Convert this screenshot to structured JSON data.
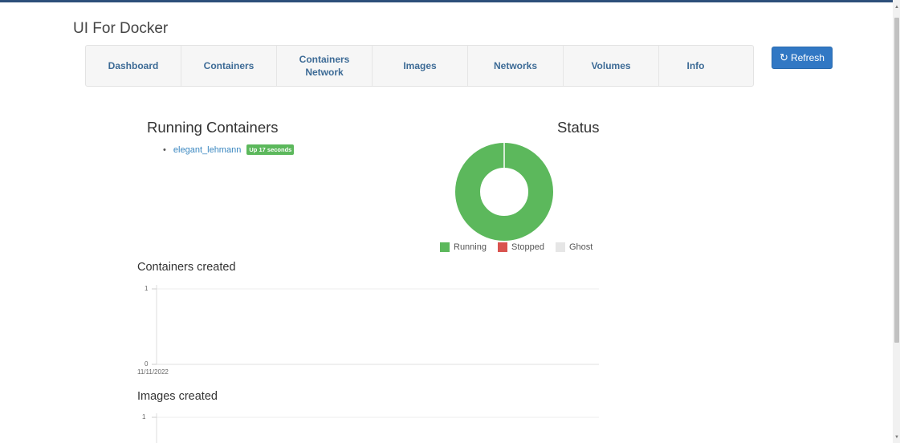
{
  "app": {
    "title": "UI For Docker"
  },
  "nav": {
    "items": [
      {
        "label": "Dashboard"
      },
      {
        "label": "Containers"
      },
      {
        "label": "Containers Network"
      },
      {
        "label": "Images"
      },
      {
        "label": "Networks"
      },
      {
        "label": "Volumes"
      },
      {
        "label": "Info"
      }
    ],
    "refresh_label": "Refresh"
  },
  "running": {
    "heading": "Running Containers",
    "containers": [
      {
        "name": "elegant_lehmann",
        "status": "Up 17 seconds"
      }
    ]
  },
  "status": {
    "heading": "Status",
    "legend": [
      {
        "label": "Running",
        "color": "#5cb85c"
      },
      {
        "label": "Stopped",
        "color": "#d9534f"
      },
      {
        "label": "Ghost",
        "color": "#e6e6e6"
      }
    ]
  },
  "containers_created": {
    "title": "Containers created"
  },
  "images_created": {
    "title": "Images created"
  },
  "chart_data": [
    {
      "type": "pie",
      "title": "Status",
      "categories": [
        "Running",
        "Stopped",
        "Ghost"
      ],
      "values": [
        1,
        0,
        0
      ],
      "colors": [
        "#5cb85c",
        "#d9534f",
        "#e6e6e6"
      ],
      "legend": "bottom"
    },
    {
      "type": "line",
      "title": "Containers created",
      "x": [
        "11/11/2022"
      ],
      "yticks": [
        "1",
        "0"
      ],
      "ylim": [
        0,
        1
      ],
      "series": []
    },
    {
      "type": "line",
      "title": "Images created",
      "x": [],
      "yticks": [
        "1"
      ],
      "ylim": [
        0,
        1
      ],
      "series": []
    }
  ]
}
